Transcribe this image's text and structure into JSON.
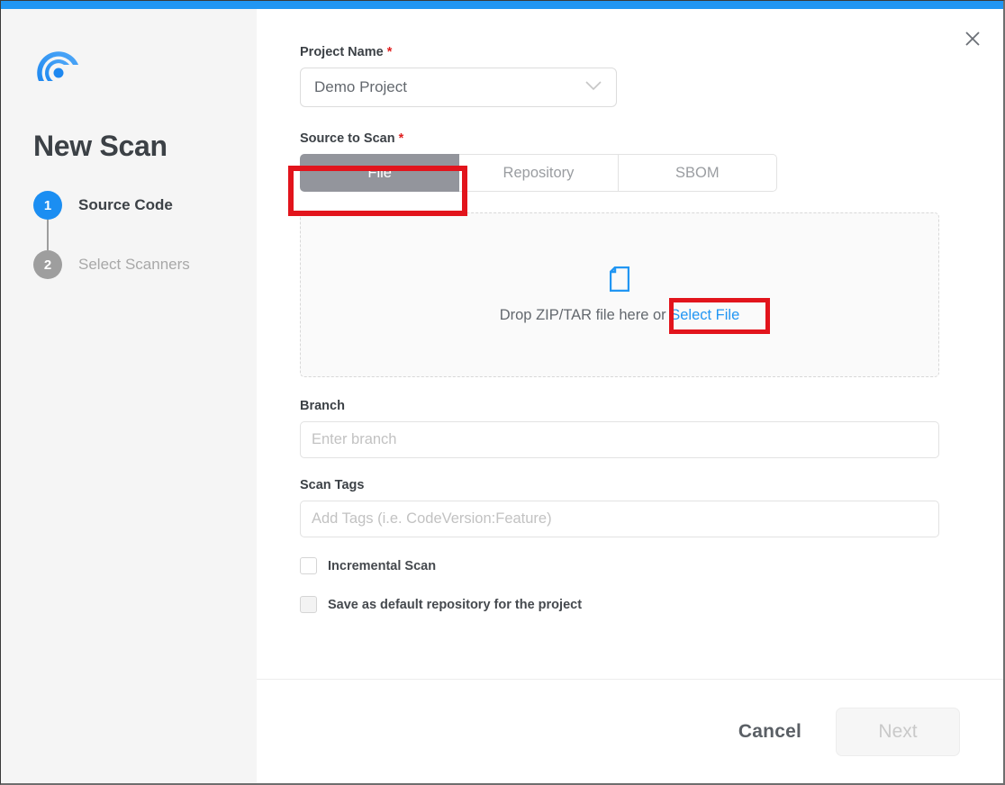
{
  "window": {
    "accent_color": "#2196f3",
    "close_icon": "close-icon"
  },
  "sidebar": {
    "logo_icon": "spiral-radar-logo-icon",
    "title": "New Scan",
    "steps": [
      {
        "number": "1",
        "label": "Source Code",
        "state": "active"
      },
      {
        "number": "2",
        "label": "Select Scanners",
        "state": "inactive"
      }
    ]
  },
  "form": {
    "project_name": {
      "label": "Project Name",
      "required_marker": "*",
      "selected_value": "Demo Project",
      "chevron_icon": "chevron-down-icon"
    },
    "source_to_scan": {
      "label": "Source to Scan",
      "required_marker": "*",
      "tabs": [
        {
          "label": "File",
          "active": true
        },
        {
          "label": "Repository",
          "active": false
        },
        {
          "label": "SBOM",
          "active": false
        }
      ]
    },
    "drop_zone": {
      "file_icon": "file-document-icon",
      "prompt_text": "Drop ZIP/TAR file here or ",
      "link_text": "Select File"
    },
    "branch": {
      "label": "Branch",
      "placeholder": "Enter branch",
      "value": ""
    },
    "scan_tags": {
      "label": "Scan Tags",
      "placeholder": "Add Tags (i.e. CodeVersion:Feature)",
      "value": ""
    },
    "checkboxes": [
      {
        "label": "Incremental Scan",
        "checked": false
      },
      {
        "label": "Save as default repository for the project",
        "checked": false
      }
    ]
  },
  "footer": {
    "cancel_label": "Cancel",
    "next_label": "Next"
  },
  "annotations": {
    "color": "#e2141c",
    "targets": [
      "file-tab",
      "select-file-link"
    ]
  }
}
